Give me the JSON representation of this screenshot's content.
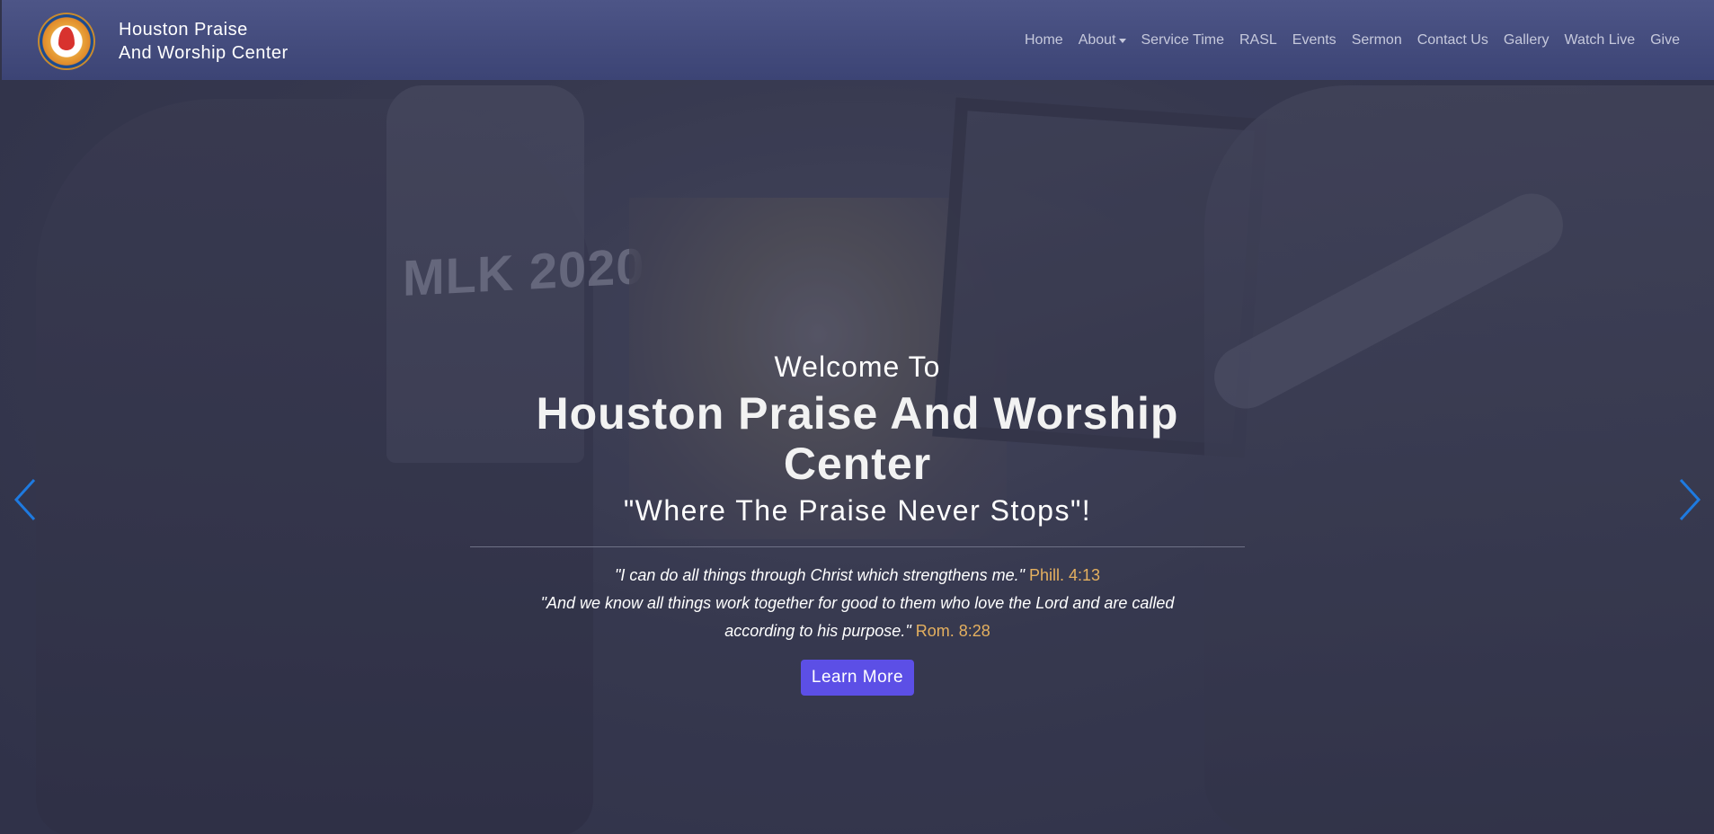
{
  "brand": {
    "line1": "Houston Praise",
    "line2": "And Worship Center"
  },
  "nav": {
    "items": [
      {
        "label": "Home"
      },
      {
        "label": "About",
        "dropdown": true
      },
      {
        "label": "Service Time"
      },
      {
        "label": "RASL"
      },
      {
        "label": "Events"
      },
      {
        "label": "Sermon"
      },
      {
        "label": "Contact Us"
      },
      {
        "label": "Gallery"
      },
      {
        "label": "Watch Live"
      },
      {
        "label": "Give"
      }
    ]
  },
  "hero": {
    "welcome": "Welcome To",
    "title": "Houston Praise And Worship Center",
    "tagline": "\"Where The Praise Never Stops\"!",
    "verse1_text": "\"I can do all things through Christ which strengthens me.\"",
    "verse1_ref": "Phill. 4:13",
    "verse2_text_line1": "\"And we know all things work together for good to them who love the Lord and are called",
    "verse2_text_line2": "according to his purpose.\"",
    "verse2_ref": "Rom. 8:28",
    "button_label": "Learn More",
    "background_text": "MLK 2020"
  },
  "icons": {
    "prev": "chevron-left-icon",
    "next": "chevron-right-icon",
    "logo": "church-logo-icon"
  },
  "colors": {
    "navbar": "#4d5587",
    "accent_button": "#5c4fe6",
    "reference": "#e5b05f",
    "carousel_arrow": "#1e7ae0"
  }
}
